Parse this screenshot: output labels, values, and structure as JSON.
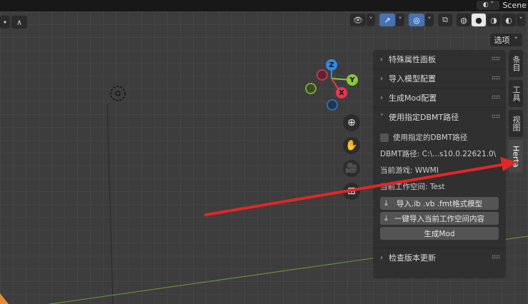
{
  "topbar": {
    "scene_label": "Scene"
  },
  "viewport_header": {
    "options_label": "选项",
    "left_tools": [
      "•",
      "∧"
    ],
    "shading_modes": [
      "wireframe",
      "solid",
      "material",
      "rendered"
    ]
  },
  "gizmo": {
    "z": "Z",
    "y": "Y",
    "x": "X"
  },
  "nav_buttons": [
    "zoom",
    "pan",
    "camera",
    "grid"
  ],
  "npanel": {
    "sections": [
      {
        "label": "特殊属性面板"
      },
      {
        "label": "导入模型配置"
      },
      {
        "label": "生成Mod配置"
      }
    ],
    "dbmt": {
      "label": "使用指定DBMT路径",
      "checkbox_label": "使用指定的DBMT路径",
      "path_text": "DBMT路径: C:\\...s10.0.22621.0\\",
      "game_text": "当前游戏: WWMI",
      "workspace_text": "当前工作空间: Test",
      "import_btn": "导入.ib .vb .fmt格式模型",
      "import_ws_btn": "一键导入当前工作空间内容",
      "generate_btn": "生成Mod"
    },
    "update_section": {
      "label": "检查版本更新"
    }
  },
  "sidetabs": [
    "条目",
    "工具",
    "视图",
    "Herta"
  ],
  "colors": {
    "accent": "#4772b3",
    "arrow": "#e32626",
    "x_axis": "#e8384f",
    "y_axis": "#8cc63f",
    "z_axis": "#2d8ceb"
  }
}
